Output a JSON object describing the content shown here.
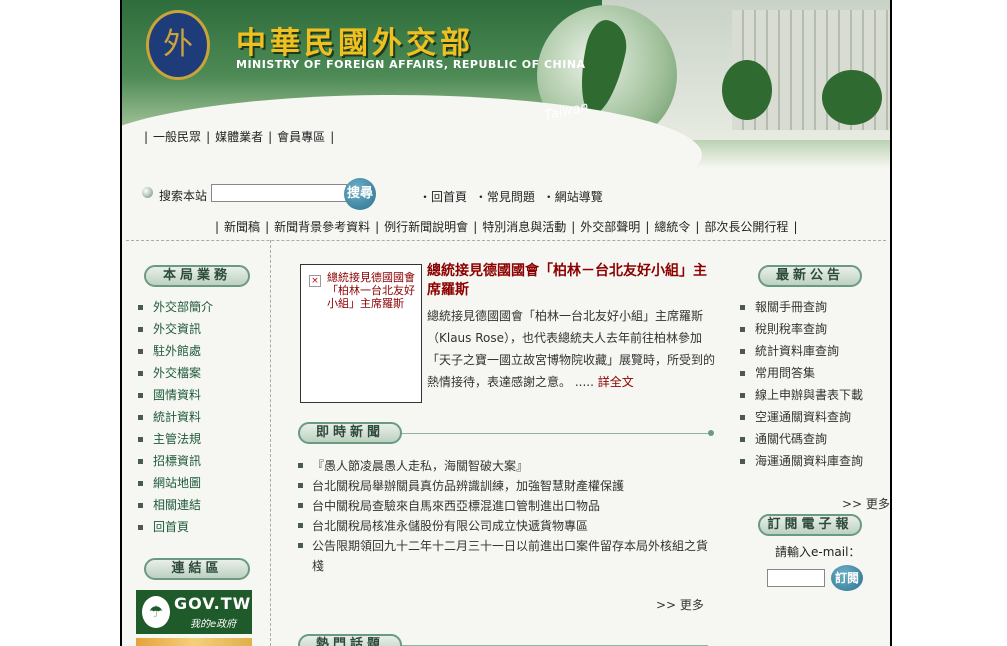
{
  "banner": {
    "title_zh": "中華民國外交部",
    "title_en": "MINISTRY OF FOREIGN AFFAIRS, REPUBLIC OF CHINA",
    "taiwan_label": "Taiwan",
    "emblem_glyph": "外"
  },
  "top_nav": [
    "一般民眾",
    "媒體業者",
    "會員專區"
  ],
  "search": {
    "label": "搜索本站",
    "value": "",
    "button_label": "搜尋"
  },
  "util_links": [
    "・回首頁",
    "・常見問題",
    "・網站導覽"
  ],
  "news_nav": [
    "新聞稿",
    "新聞背景參考資料",
    "例行新聞說明會",
    "特別消息與活動",
    "外交部聲明",
    "總統令",
    "部次長公開行程"
  ],
  "left": {
    "header": "本局業務",
    "items": [
      "外交部簡介",
      "外交資訊",
      "駐外館處",
      "外交檔案",
      "國情資料",
      "統計資料",
      "主管法規",
      "招標資訊",
      "網站地圖",
      "相關連結",
      "回首頁"
    ],
    "links_header": "連結區",
    "gov_banner": {
      "title": "GOV.TW",
      "subtitle": "我的e政府"
    }
  },
  "feature": {
    "image_alt": "總統接見德國國會「柏林一台北友好小組」主席羅斯",
    "title": "總統接見德國國會「柏林－台北友好小組」主席羅斯",
    "body": "總統接見德國國會「柏林一台北友好小組」主席羅斯（Klaus Rose），也代表總統夫人去年前往柏林參加「天子之寶一國立故宮博物院收藏」展覽時，所受到的熱情接待，表達感謝之意。 .....",
    "more_label": "詳全文"
  },
  "news": {
    "header": "即時新聞",
    "items": [
      "『愚人節凌晨愚人走私，海關智破大案』",
      "台北關稅局舉辦關員真仿品辨識訓練，加強智慧財產權保護",
      "台中關稅局查驗來自馬來西亞標混進口管制進出口物品",
      "台北關稅局核准永儲股份有限公司成立快遞貨物專區",
      "公告限期領回九十二年十二月三十一日以前進出口案件留存本局外核組之貨棧"
    ],
    "more_label": ">> 更多"
  },
  "hot_topics_header": "熱門話題",
  "right": {
    "header": "最新公告",
    "items": [
      "報關手冊查詢",
      "稅則稅率查詢",
      "統計資料庫查詢",
      "常用問答集",
      "線上申辦與書表下載",
      "空運通關資料查詢",
      "通關代碼查詢",
      "海運通關資料庫查詢"
    ],
    "more_label": ">> 更多",
    "subscribe_header": "訂閱電子報",
    "email_label": "請輸入e-mail：",
    "email_value": "",
    "subscribe_button": "訂閱"
  }
}
